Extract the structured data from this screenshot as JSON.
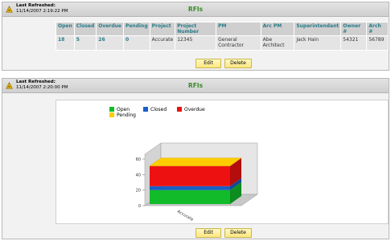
{
  "panel1": {
    "refresh_label": "Last Refreshed:",
    "refresh_time": "11/14/2007 2:19:22 PM",
    "title": "RFIs",
    "columns": [
      "Open",
      "Closed",
      "Overdue",
      "Pending",
      "Project",
      "Project Number",
      "PM",
      "Arc PM",
      "Superintendant",
      "Owner #",
      "Arch #"
    ],
    "row": [
      "18",
      "5",
      "26",
      "0",
      "Accurate",
      "12345",
      "General Contractor",
      "Abe Architect",
      "Jack Hain",
      "54321",
      "56789"
    ],
    "edit_label": "Edit",
    "delete_label": "Delete"
  },
  "panel2": {
    "refresh_label": "Last Refreshed:",
    "refresh_time": "11/14/2007 2:20:00 PM",
    "title": "RFIs",
    "edit_label": "Edit",
    "delete_label": "Delete"
  },
  "colors": {
    "open": "#11bb2a",
    "closed": "#1a5fc8",
    "overdue": "#ee1111",
    "pending": "#ffcc00",
    "title_green": "#3a8a2a"
  },
  "chart_data": {
    "type": "bar",
    "subtype": "3d-stacked",
    "categories": [
      "Accurate"
    ],
    "series": [
      {
        "name": "Open",
        "values": [
          18
        ]
      },
      {
        "name": "Closed",
        "values": [
          5
        ]
      },
      {
        "name": "Overdue",
        "values": [
          26
        ]
      },
      {
        "name": "Pending",
        "values": [
          0
        ]
      }
    ],
    "ylim": [
      0,
      60
    ],
    "yticks": [
      "0",
      "20",
      "40",
      "60"
    ],
    "legend_position": "top",
    "grid": false
  }
}
